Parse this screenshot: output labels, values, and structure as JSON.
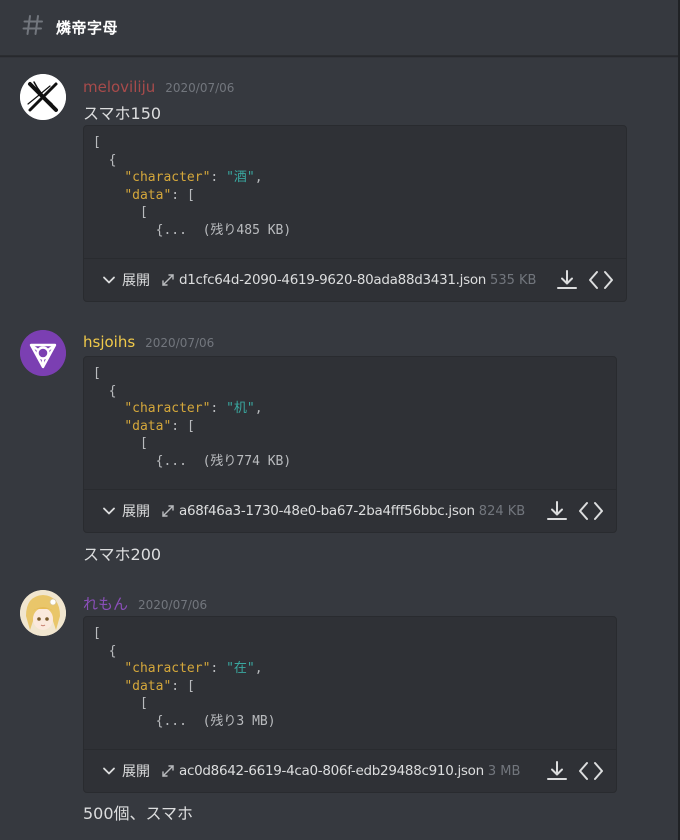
{
  "channel": {
    "icon": "hash-icon",
    "name": "燐帝字母"
  },
  "messages": [
    {
      "username": "meloviliju",
      "username_color": "#a84b4b",
      "timestamp": "2020/07/06",
      "text": "スマホ150",
      "attachment": {
        "code_open": "[",
        "code_brace": "{",
        "key_character": "\"character\"",
        "value_character": "\"酒\"",
        "key_data": "\"data\"",
        "data_open": "[",
        "inner_open": "[",
        "ellipsis": "{...",
        "remaining": "(残り485 KB)",
        "expand_label": "展開",
        "filename": "d1cfc64d-2090-4619-9620-80ada88d3431.json",
        "filesize": "535 KB"
      }
    },
    {
      "username": "hsjoihs",
      "username_color": "#f0c94a",
      "timestamp": "2020/07/06",
      "attachment": {
        "code_open": "[",
        "code_brace": "{",
        "key_character": "\"character\"",
        "value_character": "\"机\"",
        "key_data": "\"data\"",
        "data_open": "[",
        "inner_open": "[",
        "ellipsis": "{...",
        "remaining": "(残り774 KB)",
        "expand_label": "展開",
        "filename": "a68f46a3-1730-48e0-ba67-2ba4fff56bbc.json",
        "filesize": "824 KB"
      },
      "text": "スマホ200"
    },
    {
      "username": "れもん",
      "username_color": "#8a4fb8",
      "timestamp": "2020/07/06",
      "attachment": {
        "code_open": "[",
        "code_brace": "{",
        "key_character": "\"character\"",
        "value_character": "\"在\"",
        "key_data": "\"data\"",
        "data_open": "[",
        "inner_open": "[",
        "ellipsis": "{...",
        "remaining": "(残り3 MB)",
        "expand_label": "展開",
        "filename": "ac0d8642-6619-4ca0-806f-edb29488c910.json",
        "filesize": "3 MB"
      },
      "text": "500個、スマホ"
    }
  ],
  "icons": {
    "expand": "chevron-down-icon",
    "open_file": "expand-arrows-icon",
    "download": "download-icon",
    "view_code": "code-brackets-icon"
  },
  "colors": {
    "background": "#36393f",
    "attachment_bg": "#2f3136",
    "json_key": "#d4a73b",
    "json_string": "#3aa8a0"
  }
}
